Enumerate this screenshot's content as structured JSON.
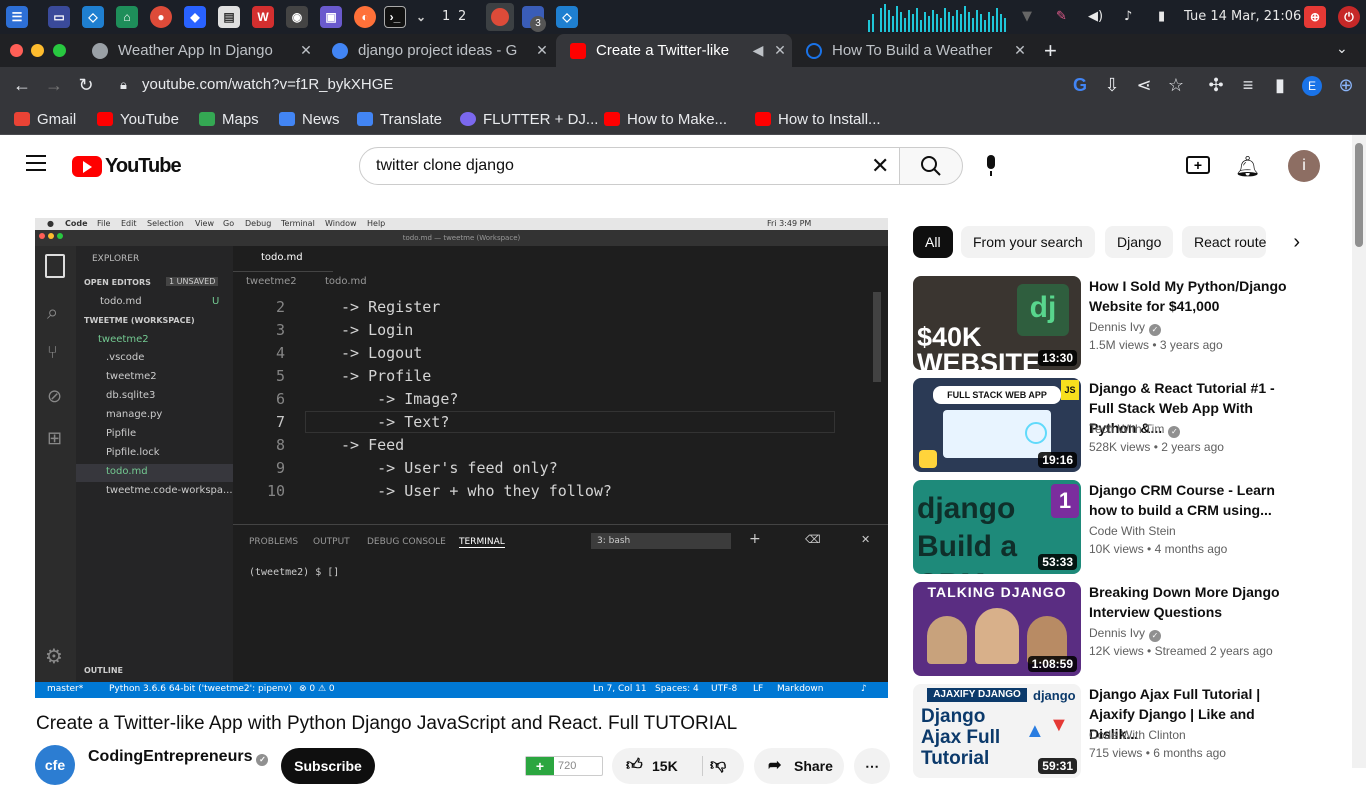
{
  "taskbar": {
    "workspaces": [
      "1",
      "2"
    ],
    "badge": "3",
    "clock": "Tue 14 Mar, 21:06"
  },
  "tabs": [
    {
      "title": "Weather App In Django",
      "favicon_color": "#9aa0a6"
    },
    {
      "title": "django project ideas - G",
      "favicon_color": "#4285f4"
    },
    {
      "title": "Create a Twitter-like",
      "favicon_color": "#ff0000"
    },
    {
      "title": "How To Build a Weather",
      "favicon_color": "#1a73e8"
    }
  ],
  "address": {
    "url": "youtube.com/watch?v=f1R_bykXHGE",
    "profile_initial": "E"
  },
  "bookmarks": [
    {
      "label": "Gmail",
      "color": "#ea4335"
    },
    {
      "label": "YouTube",
      "color": "#ff0000"
    },
    {
      "label": "Maps",
      "color": "#34a853"
    },
    {
      "label": "News",
      "color": "#4285f4"
    },
    {
      "label": "Translate",
      "color": "#4285f4"
    },
    {
      "label": "FLUTTER + DJ...",
      "color": "#7b68ee"
    },
    {
      "label": "How to Make...",
      "color": "#ff0000"
    },
    {
      "label": "How to Install...",
      "color": "#ff0000"
    }
  ],
  "youtube": {
    "logo_text": "YouTube",
    "search_value": "twitter clone  django",
    "account_initial": "i"
  },
  "player": {
    "mac_menu": [
      "Code",
      "File",
      "Edit",
      "Selection",
      "View",
      "Go",
      "Debug",
      "Terminal",
      "Window",
      "Help"
    ],
    "mac_time": "Fri 3:49 PM",
    "window_title": "todo.md — tweetme (Workspace)",
    "explorer": {
      "title": "EXPLORER",
      "open_editors": "OPEN EDITORS",
      "unsaved": "1 UNSAVED",
      "open_file": "todo.md",
      "open_file_flag": "U",
      "workspace": "TWEETME (WORKSPACE)",
      "folder": "tweetme2",
      "items": [
        ".vscode",
        "tweetme2",
        "db.sqlite3",
        "manage.py",
        "Pipfile",
        "Pipfile.lock",
        "todo.md",
        "tweetme.code-workspa..."
      ],
      "outline": "OUTLINE"
    },
    "editor_tab": "todo.md",
    "breadcrumb": [
      "tweetme2",
      "todo.md"
    ],
    "code_lines": [
      {
        "n": "2",
        "text": "-> Register"
      },
      {
        "n": "3",
        "text": "-> Login"
      },
      {
        "n": "4",
        "text": "-> Logout"
      },
      {
        "n": "5",
        "text": "-> Profile"
      },
      {
        "n": "6",
        "text": "    -> Image?"
      },
      {
        "n": "7",
        "text": "    -> Text?"
      },
      {
        "n": "8",
        "text": "-> Feed"
      },
      {
        "n": "9",
        "text": "    -> User's feed only?"
      },
      {
        "n": "10",
        "text": "    -> User + who they follow?"
      }
    ],
    "panel_tabs": [
      "PROBLEMS",
      "OUTPUT",
      "DEBUG CONSOLE",
      "TERMINAL"
    ],
    "terminal_select": "3: bash",
    "terminal_prompt": "(tweetme2) $ []",
    "status": {
      "branch": "master*",
      "python": "Python 3.6.6 64-bit ('tweetme2': pipenv)",
      "problems": "⊗ 0 ⚠ 0",
      "position": "Ln 7, Col 11",
      "spaces": "Spaces: 4",
      "encoding": "UTF-8",
      "eol": "LF",
      "language": "Markdown"
    }
  },
  "video": {
    "title": "Create a Twitter-like App with Python Django JavaScript and React. Full TUTORIAL",
    "channel_initials": "cfe",
    "channel": "CodingEntrepreneurs",
    "subscribe": "Subscribe",
    "likes": "15K",
    "share": "Share",
    "rating": "720"
  },
  "chips": [
    "All",
    "From your search",
    "Django",
    "React routers"
  ],
  "related": [
    {
      "title": "How I Sold My Python/Django Website for $41,000",
      "channel": "Dennis Ivy",
      "verified": true,
      "views": "1.5M views",
      "age": "3 years ago",
      "duration": "13:30",
      "thumb_text": "$40K WEBSITE",
      "thumb_bg": "#3a3530"
    },
    {
      "title": "Django & React Tutorial #1 - Full Stack Web App With Python &...",
      "channel": "Tech With Tim",
      "verified": true,
      "views": "528K views",
      "age": "2 years ago",
      "duration": "19:16",
      "thumb_text": "FULL STACK WEB APP",
      "thumb_bg": "#2b3a55"
    },
    {
      "title": "Django CRM Course - Learn how to build a CRM using...",
      "channel": "Code With Stein",
      "verified": false,
      "views": "10K views",
      "age": "4 months ago",
      "duration": "53:33",
      "thumb_text": "django Build a CRM",
      "thumb_bg": "#1e8a7a"
    },
    {
      "title": "Breaking Down More Django Interview Questions",
      "channel": "Dennis Ivy",
      "verified": true,
      "views": "12K views",
      "age": "Streamed 2 years ago",
      "duration": "1:08:59",
      "thumb_text": "TALKING DJANGO",
      "thumb_bg": "#5a2d82"
    },
    {
      "title": "Django Ajax Full Tutorial | Ajaxify Django | Like and Dislik...",
      "channel": "Code With Clinton",
      "verified": false,
      "views": "715 views",
      "age": "6 months ago",
      "duration": "59:31",
      "thumb_text": "Django Ajax Full Tutorial",
      "thumb_bg": "#f3f3f3"
    }
  ]
}
